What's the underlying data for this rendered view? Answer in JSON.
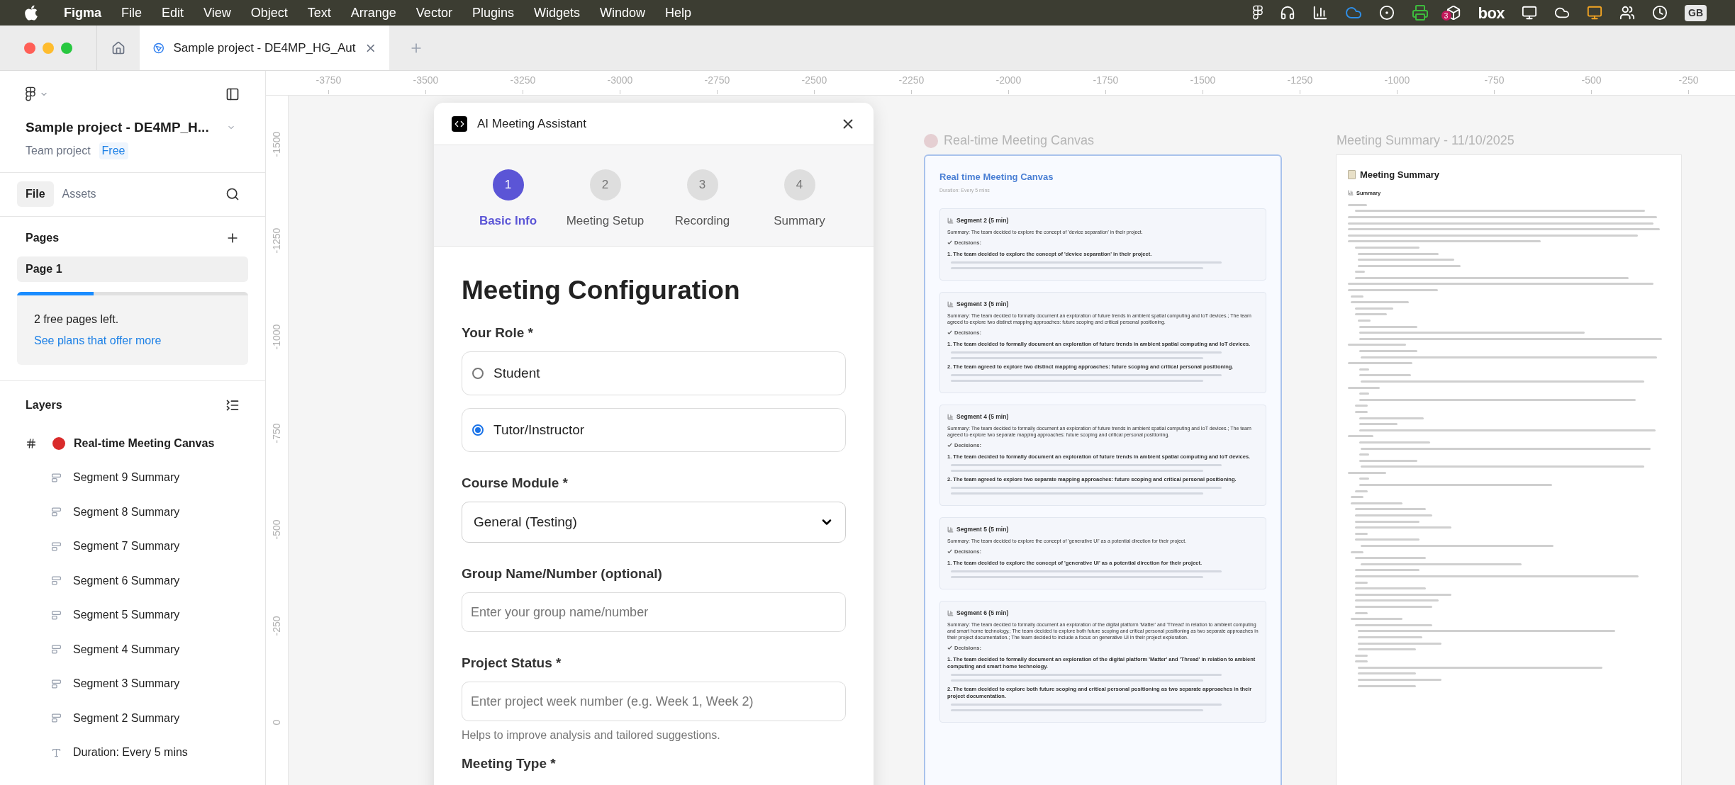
{
  "menu_bar": {
    "app": "Figma",
    "menus": [
      "File",
      "Edit",
      "View",
      "Object",
      "Text",
      "Arrange",
      "Vector",
      "Plugins",
      "Widgets",
      "Window",
      "Help"
    ],
    "tray_box_label": "box",
    "tray_badge": "3",
    "input_source": "GB"
  },
  "tab_bar": {
    "tabs": [
      {
        "title": "Sample project - DE4MP_HG_Aut",
        "selected": true
      }
    ]
  },
  "sidebar": {
    "project_name": "Sample project - DE4MP_H...",
    "project_type": "Team project",
    "plan_badge": "Free",
    "tabs": [
      {
        "label": "File",
        "selected": true
      },
      {
        "label": "Assets",
        "selected": false
      }
    ],
    "pages_title": "Pages",
    "pages": [
      {
        "name": "Page 1",
        "selected": true
      }
    ],
    "pages_quota": {
      "level": 0.33,
      "text": "2 free pages left.",
      "link": "See plans that offer more"
    },
    "layers_title": "Layers",
    "layers": [
      {
        "name": "Real-time Meeting Canvas",
        "kind": "frame",
        "children": [
          {
            "name": "Segment 9 Summary",
            "kind": "text-block"
          },
          {
            "name": "Segment 8 Summary",
            "kind": "text-block"
          },
          {
            "name": "Segment 7 Summary",
            "kind": "text-block"
          },
          {
            "name": "Segment 6 Summary",
            "kind": "text-block"
          },
          {
            "name": "Segment 5 Summary",
            "kind": "text-block"
          },
          {
            "name": "Segment 4 Summary",
            "kind": "text-block"
          },
          {
            "name": "Segment 3 Summary",
            "kind": "text-block"
          },
          {
            "name": "Segment 2 Summary",
            "kind": "text-block"
          },
          {
            "name": "Duration: Every 5 mins",
            "kind": "text"
          }
        ]
      }
    ]
  },
  "rulers": {
    "horizontal": [
      "-3750",
      "-3500",
      "-3250",
      "-3000",
      "-2750",
      "-2500",
      "-2250",
      "-2000",
      "-1750",
      "-1500",
      "-1250",
      "-1000",
      "-750",
      "-500",
      "-250"
    ],
    "vertical": [
      "-1500",
      "-1250",
      "-1000",
      "-750",
      "-500",
      "-250",
      "0"
    ]
  },
  "plugin": {
    "title": "AI Meeting Assistant",
    "steps": [
      {
        "number": "1",
        "label": "Basic Info",
        "selected": true
      },
      {
        "number": "2",
        "label": "Meeting Setup",
        "selected": false
      },
      {
        "number": "3",
        "label": "Recording",
        "selected": false
      },
      {
        "number": "4",
        "label": "Summary",
        "selected": false
      }
    ],
    "heading": "Meeting Configuration",
    "fields": [
      {
        "kind": "radio-group",
        "label": "Your Role *",
        "options": [
          {
            "label": "Student",
            "selected": false
          },
          {
            "label": "Tutor/Instructor",
            "selected": true
          }
        ]
      },
      {
        "kind": "select",
        "label": "Course Module *",
        "value": "General (Testing)"
      },
      {
        "kind": "text",
        "label": "Group Name/Number (optional)",
        "placeholder": "Enter your group name/number"
      },
      {
        "kind": "text",
        "label": "Project Status *",
        "placeholder": "Enter project week number (e.g. Week 1, Week 2)",
        "hint": "Helps to improve analysis and tailored suggestions."
      },
      {
        "kind": "label",
        "label": "Meeting Type *"
      }
    ]
  },
  "live_canvas": {
    "frame_title": "Real-time Meeting Canvas",
    "heading": "Real time Meeting Canvas",
    "subtitle": "Duration: Every 5 mins",
    "segments": [
      {
        "title": "Segment 2 (5 min)",
        "summary": "Summary: The team decided to explore the concept of 'device separation' in their project.",
        "decisions_label": "Decisions:",
        "decisions": [
          "1. The team decided to explore the concept of 'device separation' in their project."
        ]
      },
      {
        "title": "Segment 3 (5 min)",
        "summary": "Summary: The team decided to formally document an exploration of future trends in ambient spatial computing and IoT devices.; The team agreed to explore two distinct mapping approaches: future scoping and critical personal positioning.",
        "decisions_label": "Decisions:",
        "decisions": [
          "1. The team decided to formally document an exploration of future trends in ambient spatial computing and IoT devices.",
          "2. The team agreed to explore two distinct mapping approaches: future scoping and critical personal positioning."
        ]
      },
      {
        "title": "Segment 4 (5 min)",
        "summary": "Summary: The team decided to formally document an exploration of future trends in ambient spatial computing and IoT devices.; The team agreed to explore two separate mapping approaches: future scoping and critical personal positioning.",
        "decisions_label": "Decisions:",
        "decisions": [
          "1. The team decided to formally document an exploration of future trends in ambient spatial computing and IoT devices.",
          "2. The team agreed to explore two separate mapping approaches: future scoping and critical personal positioning."
        ]
      },
      {
        "title": "Segment 5 (5 min)",
        "summary": "Summary: The team decided to explore the concept of 'generative UI' as a potential direction for their project.",
        "decisions_label": "Decisions:",
        "decisions": [
          "1. The team decided to explore the concept of 'generative UI' as a potential direction for their project."
        ]
      },
      {
        "title": "Segment 6 (5 min)",
        "summary": "Summary: The team decided to formally document an exploration of the digital platform 'Matter' and 'Thread' in relation to ambient computing and smart home technology.; The team decided to explore both future scoping and critical personal positioning as two separate approaches in their project documentation.; The team decided to include a focus on generative UI in their project exploration.",
        "decisions_label": "Decisions:",
        "decisions": [
          "1. The team decided to formally document an exploration of the digital platform 'Matter' and 'Thread' in relation to ambient computing and smart home technology.",
          "2. The team decided to explore both future scoping and critical personal positioning as two separate approaches in their project documentation."
        ]
      }
    ]
  },
  "summary_canvas": {
    "frame_title": "Meeting Summary - 11/10/2025",
    "heading": "Meeting Summary",
    "section": "Summary"
  }
}
